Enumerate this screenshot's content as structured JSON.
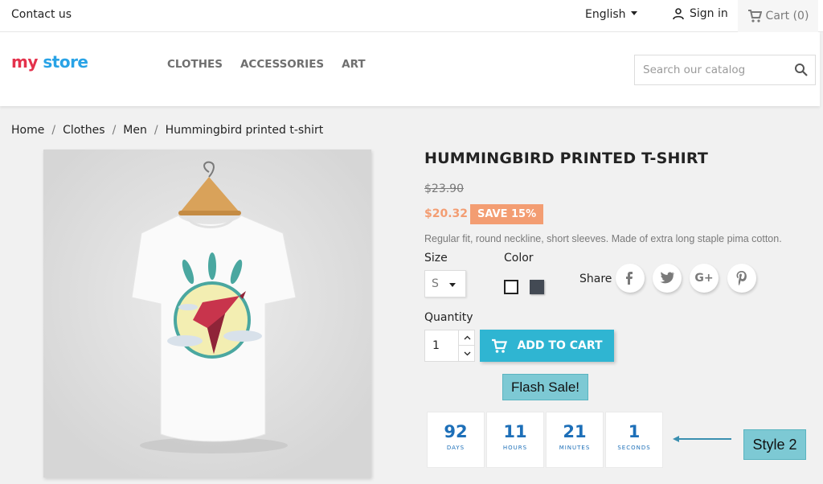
{
  "topbar": {
    "contact": "Contact us",
    "language": "English",
    "signin": "Sign in",
    "cart": "Cart (0)"
  },
  "header": {
    "logo": {
      "part1": "my",
      "part2": "store",
      "colors": [
        "#e4324c",
        "#29a3e6",
        "#f6b02a",
        "#6a3da0"
      ]
    },
    "nav": [
      "CLOTHES",
      "ACCESSORIES",
      "ART"
    ],
    "search_placeholder": "Search our catalog"
  },
  "breadcrumb": [
    "Home",
    "Clothes",
    "Men",
    "Hummingbird printed t-shirt"
  ],
  "product": {
    "title": "HUMMINGBIRD PRINTED T-SHIRT",
    "old_price": "$23.90",
    "price": "$20.32",
    "discount": "SAVE 15%",
    "description": "Regular fit, round neckline, short sleeves. Made of extra long staple pima cotton.",
    "size_label": "Size",
    "size_value": "S",
    "color_label": "Color",
    "colors": [
      "#ffffff",
      "#434a54"
    ],
    "share_label": "Share",
    "share_icons": [
      "facebook-icon",
      "twitter-icon",
      "google-plus-icon",
      "pinterest-icon"
    ],
    "quantity_label": "Quantity",
    "quantity_value": "1",
    "add_to_cart": "ADD TO CART"
  },
  "flash_sale": "Flash Sale!",
  "countdown": [
    {
      "value": "92",
      "unit": "DAYS"
    },
    {
      "value": "11",
      "unit": "HOURS"
    },
    {
      "value": "21",
      "unit": "MINUTES"
    },
    {
      "value": "1",
      "unit": "SECONDS"
    }
  ],
  "annotation": "Style 2",
  "accent_colors": {
    "primary": "#2fb5d2",
    "sale": "#f39d72",
    "countdown": "#1d6fb8"
  }
}
